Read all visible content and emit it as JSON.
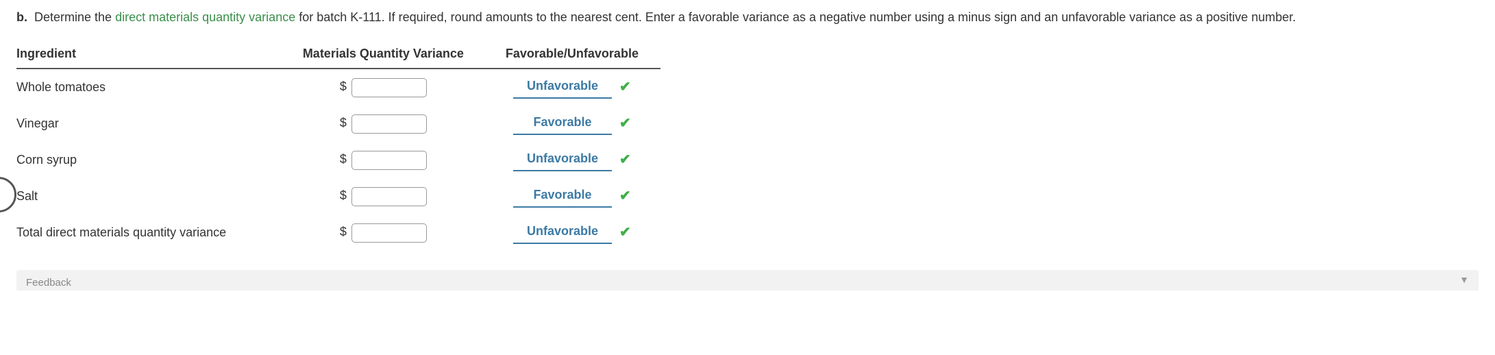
{
  "prompt": {
    "label": "b.",
    "lead": "Determine the",
    "link_text": "direct materials quantity variance",
    "rest": "for batch K-111. If required, round amounts to the nearest cent. Enter a favorable variance as a negative number using a minus sign and an unfavorable variance as a positive number."
  },
  "table": {
    "headers": {
      "ingredient": "Ingredient",
      "variance": "Materials Quantity Variance",
      "favorable": "Favorable/Unfavorable"
    },
    "currency_symbol": "$",
    "rows": [
      {
        "ingredient": "Whole tomatoes",
        "amount": "",
        "favorable": "Unfavorable"
      },
      {
        "ingredient": "Vinegar",
        "amount": "",
        "favorable": "Favorable"
      },
      {
        "ingredient": "Corn syrup",
        "amount": "",
        "favorable": "Unfavorable"
      },
      {
        "ingredient": "Salt",
        "amount": "",
        "favorable": "Favorable"
      },
      {
        "ingredient": "Total direct materials quantity variance",
        "amount": "",
        "favorable": "Unfavorable"
      }
    ]
  },
  "feedback": {
    "label": "Feedback"
  },
  "icons": {
    "check": "✔",
    "chevron_down": "▼"
  },
  "colors": {
    "link_green": "#3a8f4a",
    "select_blue": "#3b7aa5",
    "check_green": "#3fae49"
  }
}
